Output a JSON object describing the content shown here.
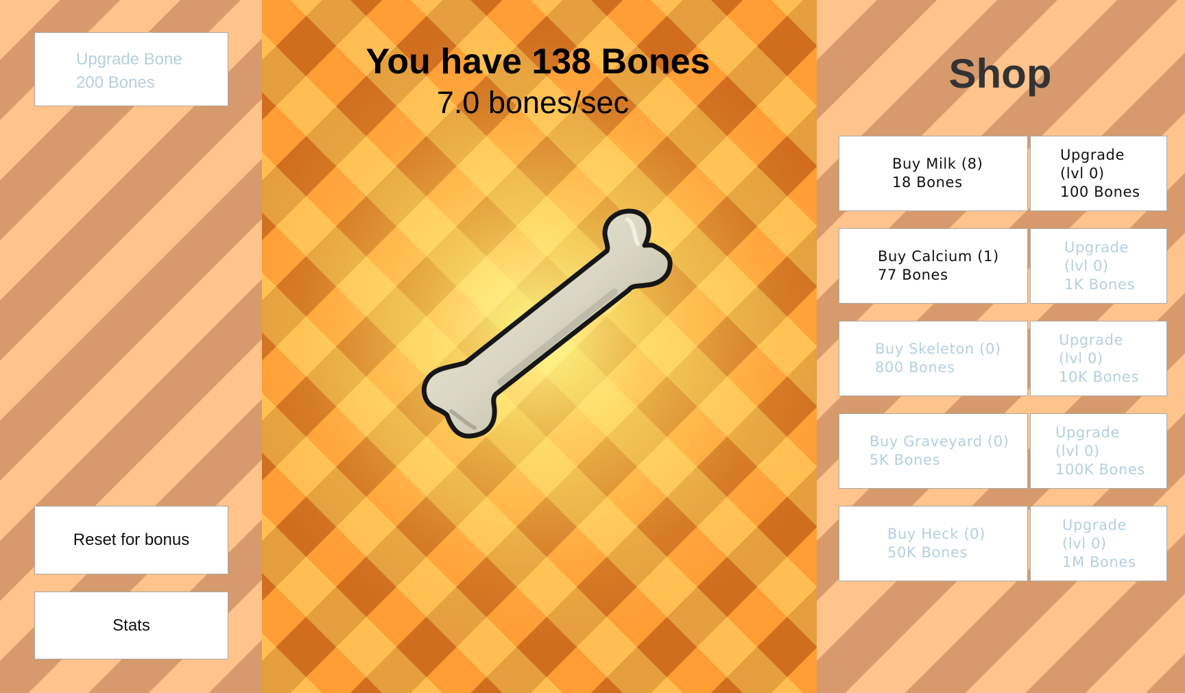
{
  "sidebar": {
    "upgrade_bone": {
      "title": "Upgrade Bone",
      "cost": "200 Bones"
    },
    "reset_label": "Reset for bonus",
    "stats_label": "Stats"
  },
  "main": {
    "bones_count_text": "You have 138 Bones",
    "bones_rate_text": "7.0 bones/sec",
    "bone_icon": "bone-icon"
  },
  "shop": {
    "title": "Shop",
    "items": [
      {
        "buy_label": "Buy Milk (8)",
        "buy_cost": "18 Bones",
        "upgrade_label": "Upgrade",
        "upgrade_level": "(lvl 0)",
        "upgrade_cost": "100 Bones"
      },
      {
        "buy_label": "Buy Calcium (1)",
        "buy_cost": "77 Bones",
        "upgrade_label": "Upgrade",
        "upgrade_level": "(lvl 0)",
        "upgrade_cost": "1K Bones"
      },
      {
        "buy_label": "Buy Skeleton (0)",
        "buy_cost": "800 Bones",
        "upgrade_label": "Upgrade",
        "upgrade_level": "(lvl 0)",
        "upgrade_cost": "10K Bones"
      },
      {
        "buy_label": "Buy Graveyard (0)",
        "buy_cost": "5K Bones",
        "upgrade_label": "Upgrade",
        "upgrade_level": "(lvl 0)",
        "upgrade_cost": "100K Bones"
      },
      {
        "buy_label": "Buy Heck (0)",
        "buy_cost": "50K Bones",
        "upgrade_label": "Upgrade",
        "upgrade_level": "(lvl 0)",
        "upgrade_cost": "1M Bones"
      }
    ]
  },
  "colors": {
    "enabled_text": "#101010",
    "disabled_text": "#b6cfe0",
    "title_text": "#000000",
    "shop_title": "#333333"
  }
}
